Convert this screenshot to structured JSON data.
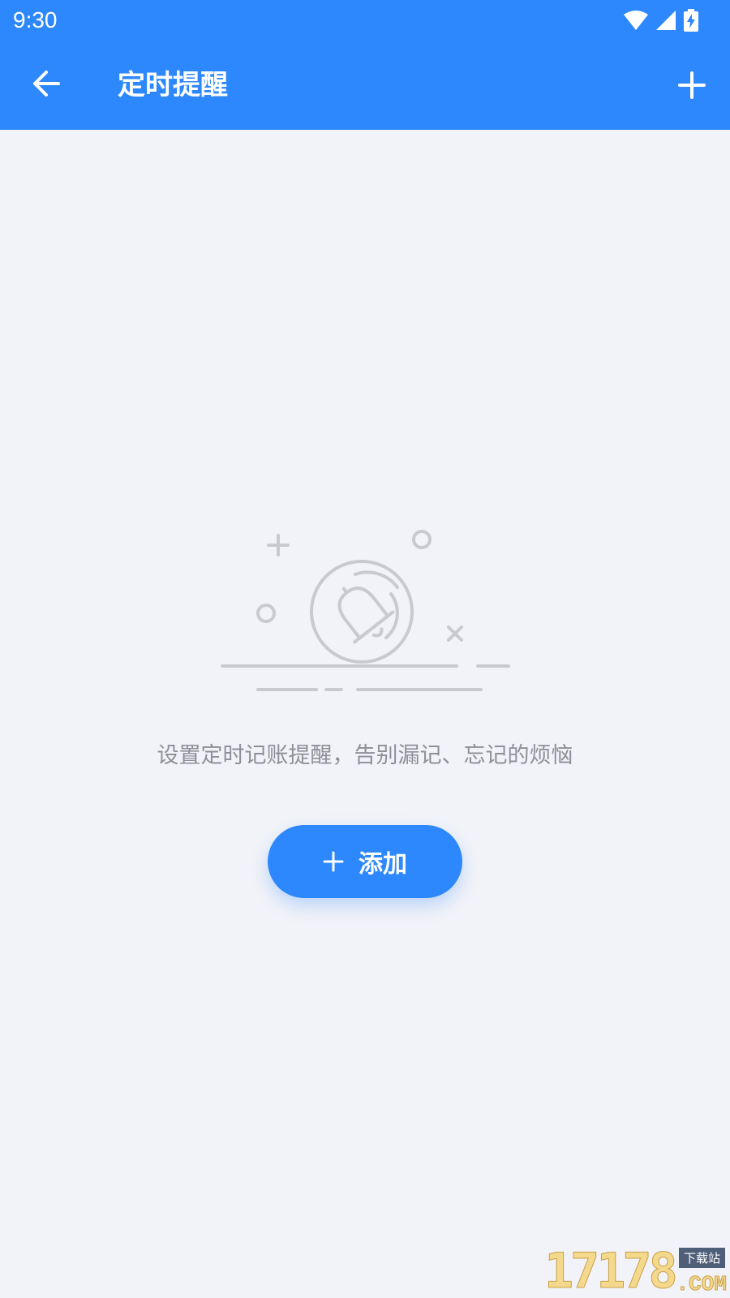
{
  "status_bar": {
    "time": "9:30",
    "icons": [
      "wifi-icon",
      "signal-icon",
      "battery-charging-icon"
    ]
  },
  "app_bar": {
    "title": "定时提醒",
    "back_icon": "arrow-left-icon",
    "add_icon": "plus-icon"
  },
  "empty_state": {
    "illustration": "bell-icon",
    "message": "设置定时记账提醒，告别漏记、忘记的烦恼",
    "button_label": "添加",
    "button_icon": "plus-icon"
  },
  "watermark": {
    "number": "17178",
    "tag": "下载站",
    "suffix": ".COM"
  },
  "colors": {
    "primary": "#2e88fd",
    "background": "#f2f3f8",
    "text_secondary": "#8f8f97",
    "illustration": "#c9c9ce"
  }
}
